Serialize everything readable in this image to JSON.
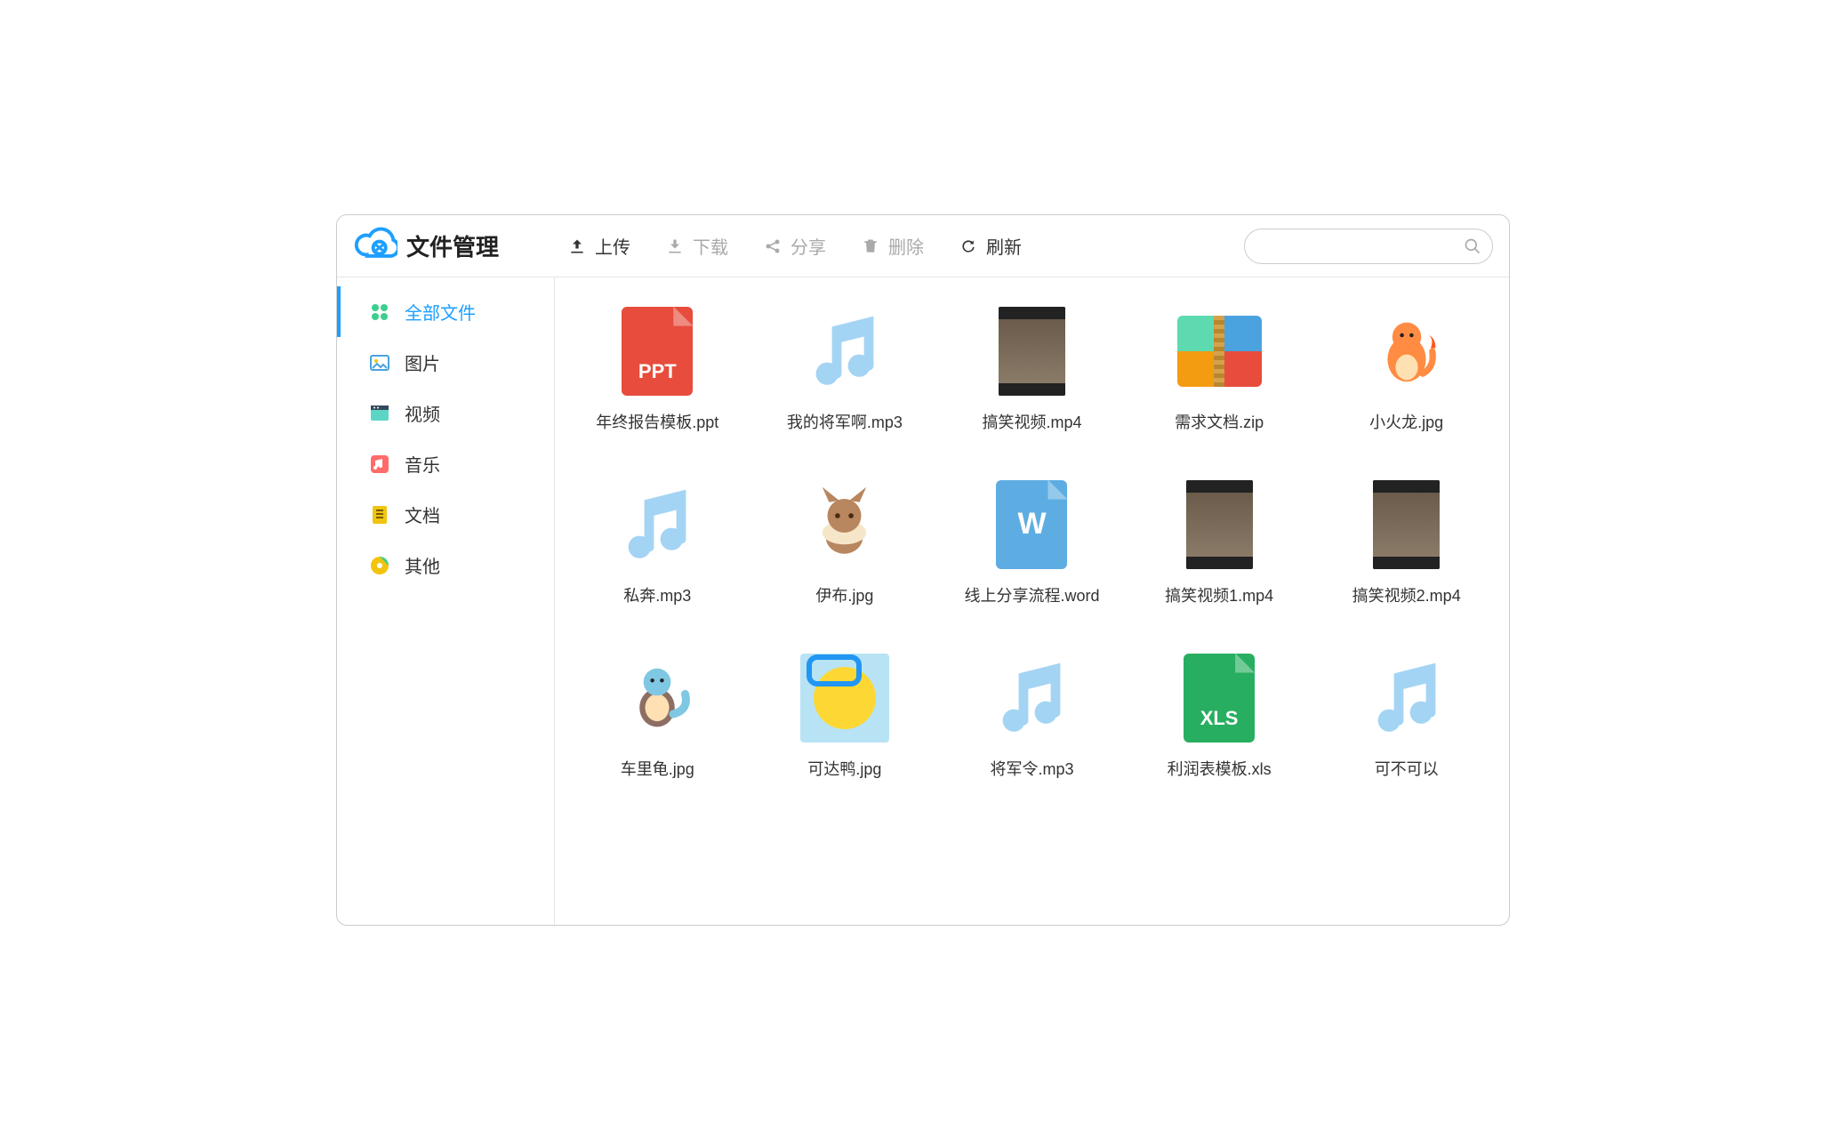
{
  "app": {
    "title": "文件管理"
  },
  "toolbar": {
    "upload": {
      "label": "上传",
      "enabled": true
    },
    "download": {
      "label": "下载",
      "enabled": false
    },
    "share": {
      "label": "分享",
      "enabled": false
    },
    "delete": {
      "label": "删除",
      "enabled": false
    },
    "refresh": {
      "label": "刷新",
      "enabled": true
    }
  },
  "search": {
    "placeholder": ""
  },
  "sidebar": {
    "items": [
      {
        "id": "all",
        "label": "全部文件",
        "active": true
      },
      {
        "id": "image",
        "label": "图片",
        "active": false
      },
      {
        "id": "video",
        "label": "视频",
        "active": false
      },
      {
        "id": "music",
        "label": "音乐",
        "active": false
      },
      {
        "id": "doc",
        "label": "文档",
        "active": false
      },
      {
        "id": "other",
        "label": "其他",
        "active": false
      }
    ]
  },
  "files": [
    {
      "name": "年终报告模板.ppt",
      "type": "ppt"
    },
    {
      "name": "我的将军啊.mp3",
      "type": "audio"
    },
    {
      "name": "搞笑视频.mp4",
      "type": "video"
    },
    {
      "name": "需求文档.zip",
      "type": "zip"
    },
    {
      "name": "小火龙.jpg",
      "type": "image",
      "variant": "charmander"
    },
    {
      "name": "私奔.mp3",
      "type": "audio"
    },
    {
      "name": "伊布.jpg",
      "type": "image",
      "variant": "eevee"
    },
    {
      "name": "线上分享流程.word",
      "type": "word"
    },
    {
      "name": "搞笑视频1.mp4",
      "type": "video"
    },
    {
      "name": "搞笑视频2.mp4",
      "type": "video"
    },
    {
      "name": "车里龟.jpg",
      "type": "image",
      "variant": "squirtle"
    },
    {
      "name": "可达鸭.jpg",
      "type": "image",
      "variant": "psyduck"
    },
    {
      "name": "将军令.mp3",
      "type": "audio"
    },
    {
      "name": "利润表模板.xls",
      "type": "xls"
    },
    {
      "name": "可不可以",
      "type": "audio"
    }
  ]
}
